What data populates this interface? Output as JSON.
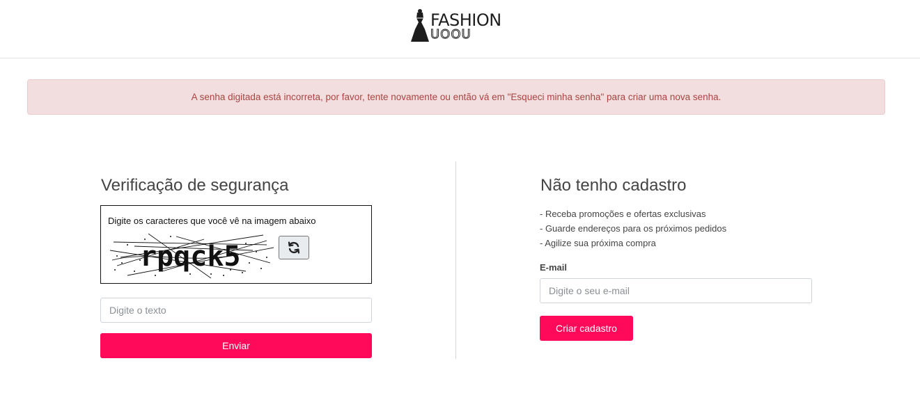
{
  "header": {
    "logo_line1": "FASHION",
    "logo_line2": "UOOU"
  },
  "alert": {
    "message": "A senha digitada está incorreta, por favor, tente novamente ou então vá em \"Esqueci minha senha\" para criar uma nova senha."
  },
  "verification": {
    "title": "Verificação de segurança",
    "captcha_instruction": "Digite os caracteres que você vê na imagem abaixo",
    "captcha_text": "rpqck5",
    "refresh_icon": "refresh-icon",
    "input_placeholder": "Digite o texto",
    "submit_label": "Enviar"
  },
  "register": {
    "title": "Não tenho cadastro",
    "benefits": [
      "- Receba promoções e ofertas exclusivas",
      "- Guarde endereços para os próximos pedidos",
      "- Agilize sua próxima compra"
    ],
    "email_label": "E-mail",
    "email_placeholder": "Digite o seu e-mail",
    "submit_label": "Criar cadastro"
  },
  "colors": {
    "accent": "#ff0a5a",
    "alert_bg": "#f2dede",
    "alert_text": "#a94442"
  }
}
